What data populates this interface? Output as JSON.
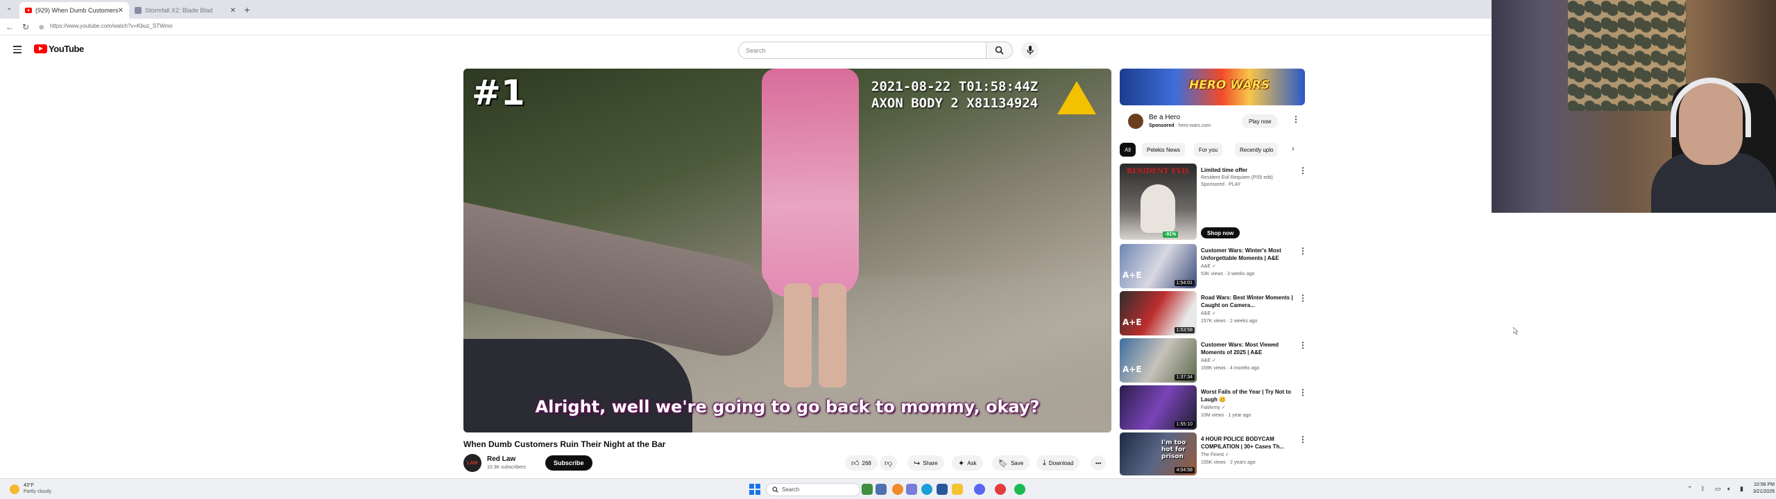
{
  "browser": {
    "tabs": [
      {
        "label": "(929) When Dumb Customers",
        "active": true
      },
      {
        "label": "Stormfall X2: Blade Blad",
        "active": false
      }
    ],
    "url": "https://www.youtube.com/watch?v=Kbuz_STWmo"
  },
  "header": {
    "logo_text": "YouTube",
    "search_placeholder": "Search"
  },
  "player": {
    "rank_overlay": "#1",
    "bodycam_stamp": "2021-08-22 T01:58:44Z\nAXON BODY 2 X81134924",
    "caption": "Alright, well we're going to go back to mommy, okay?"
  },
  "video": {
    "title": "When Dumb Customers Ruin Their Night at the Bar",
    "channel": {
      "avatar_text": "LAW",
      "name": "Red Law",
      "subscribers": "10.3K subscribers",
      "subscribe_label": "Subscribe"
    },
    "actions": {
      "likes": "268",
      "share": "Share",
      "ask": "Ask",
      "save": "Save",
      "download": "Download"
    }
  },
  "sidebar": {
    "ad": {
      "banner_text": "HERO WARS",
      "title": "Be a Hero",
      "sponsored": "Sponsored",
      "domain": "hero-wars.com",
      "cta": "Play now"
    },
    "chips": [
      "All",
      "Pelekis News",
      "For you",
      "Recently uplo"
    ],
    "recommendations": [
      {
        "title": "Limited time offer",
        "line2": "Resident Evil Requiem (PS5 edit)",
        "line3": "Sponsored · PLAY",
        "cta": "Shop now",
        "badge": "-91%",
        "thumb_text": "RESIDENT EVIL"
      },
      {
        "title": "Customer Wars: Winter's Most Unforgettable Moments | A&E",
        "channel": "A&E",
        "meta": "53K views · 3 weeks ago",
        "duration": "1:54:01",
        "thumb_text": "A+E"
      },
      {
        "title": "Road Wars: Best Winter Moments | Caught on Camera...",
        "channel": "A&E",
        "meta": "157K views · 2 weeks ago",
        "duration": "1:53:58",
        "thumb_text": "A+E"
      },
      {
        "title": "Customer Wars: Most Viewed Moments of 2025 | A&E",
        "channel": "A&E",
        "meta": "169K views · 4 months ago",
        "duration": "1:37:34",
        "thumb_text": "A+E"
      },
      {
        "title": "Worst Fails of the Year | Try Not to Laugh 🥴",
        "channel": "FailArmy",
        "meta": "10M views · 1 year ago",
        "duration": "1:55:10",
        "thumb_text": ""
      },
      {
        "title": "4 HOUR POLICE BODYCAM COMPILATION | 30+ Cases Th...",
        "channel": "The Finest",
        "meta": "155K views · 2 years ago",
        "duration": "4:04:58",
        "thumb_text": "I'm too hot for prison"
      }
    ]
  },
  "taskbar": {
    "weather_temp": "43°F",
    "weather_cond": "Partly cloudy",
    "search_label": "Search",
    "time": "10:58 PM",
    "date": "3/21/2026"
  },
  "colors": {
    "yt_red": "#ff0000",
    "caption_outline": "#4b0b45",
    "axon_yellow": "#f2c100"
  }
}
